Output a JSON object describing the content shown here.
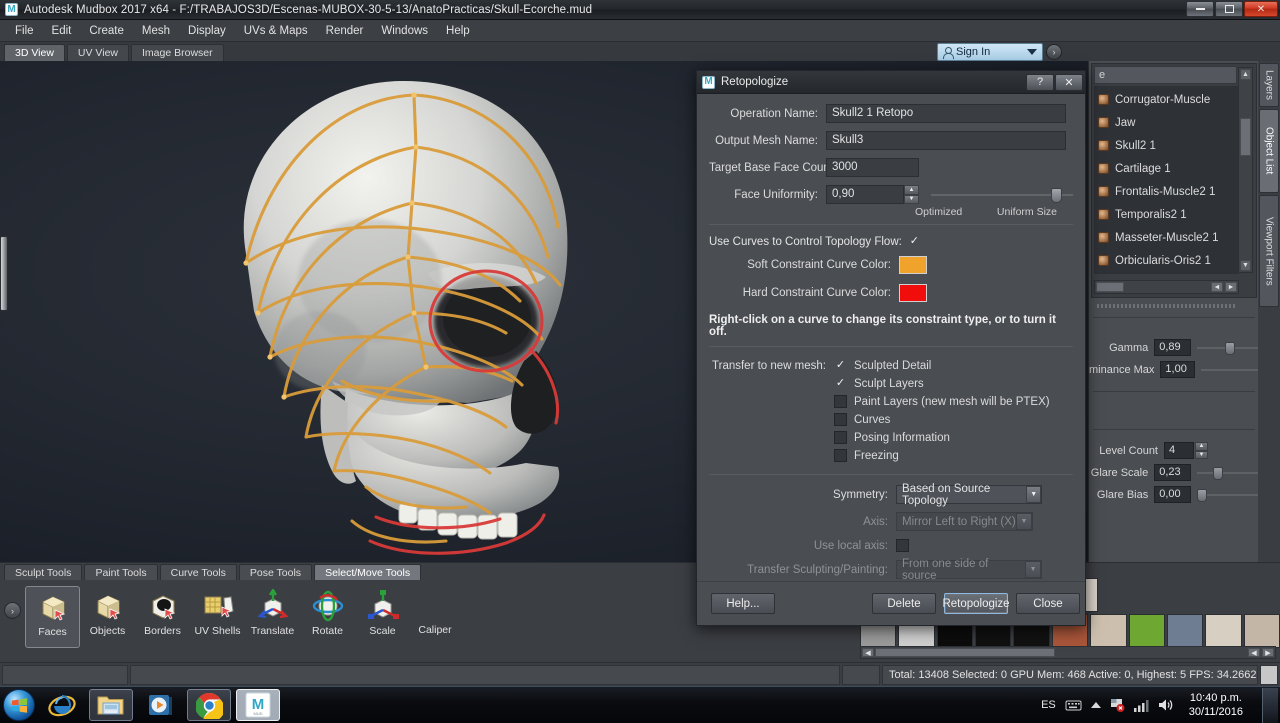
{
  "window": {
    "title": "Autodesk Mudbox 2017 x64 - F:/TRABAJOS3D/Escenas-MUBOX-30-5-13/AnatoPracticas/Skull-Ecorche.mud",
    "logo_letter": "M",
    "controls": {
      "minimize": "—",
      "restore": "❐",
      "close": "✕"
    }
  },
  "menu": {
    "items": [
      "File",
      "Edit",
      "Create",
      "Mesh",
      "Display",
      "UVs & Maps",
      "Render",
      "Windows",
      "Help"
    ]
  },
  "view_tabs": {
    "items": [
      "3D View",
      "UV View",
      "Image Browser"
    ],
    "active": "3D View"
  },
  "signin": {
    "label": "Sign In",
    "icon": "person-icon",
    "caret": "chevron-down-icon",
    "help_icon": "help-circle-icon"
  },
  "side_tabs": {
    "items": [
      "Layers",
      "Object List",
      "Viewport Filters"
    ],
    "active": "Object List"
  },
  "object_list": {
    "header_value": "e",
    "items": [
      "Corrugator-Muscle",
      "Jaw",
      "Skull2 1",
      "Cartilage 1",
      "Frontalis-Muscle2 1",
      "Temporalis2 1",
      "Masseter-Muscle2 1",
      "Orbicularis-Oris2 1"
    ],
    "scroll_up": "▲",
    "scroll_down": "▼",
    "scroll_left": "◄",
    "scroll_right": "►"
  },
  "viewport_props": {
    "gamma": {
      "label": "Gamma",
      "value": "0,89"
    },
    "luminance_max": {
      "label": "minance Max",
      "value": "1,00"
    },
    "level_count": {
      "label": "Level Count",
      "value": "4"
    },
    "glare_scale": {
      "label": "Glare Scale",
      "value": "0,23"
    },
    "glare_bias": {
      "label": "Glare Bias",
      "value": "0,00"
    }
  },
  "tool_tabs": {
    "items": [
      "Sculpt Tools",
      "Paint Tools",
      "Curve Tools",
      "Pose Tools",
      "Select/Move Tools"
    ],
    "active": "Select/Move Tools"
  },
  "tools": [
    {
      "label": "Faces",
      "icon": "cube-faces-icon",
      "selected": true
    },
    {
      "label": "Objects",
      "icon": "cube-objects-icon",
      "selected": false
    },
    {
      "label": "Borders",
      "icon": "cube-borders-icon",
      "selected": false
    },
    {
      "label": "UV Shells",
      "icon": "uv-shells-icon",
      "selected": false
    },
    {
      "label": "Translate",
      "icon": "translate-gizmo-icon",
      "selected": false
    },
    {
      "label": "Rotate",
      "icon": "rotate-gizmo-icon",
      "selected": false
    },
    {
      "label": "Scale",
      "icon": "scale-gizmo-icon",
      "selected": false
    },
    {
      "label": "Caliper",
      "icon": "caliper-icon",
      "selected": false
    }
  ],
  "collapse_knob": "›",
  "statusbar": {
    "text": "Total: 13408  Selected: 0 GPU Mem: 468  Active: 0, Highest: 5  FPS: 34.2662"
  },
  "tray": {
    "row1": [
      "#141414",
      "#8d8d8d",
      "#a0a0a0",
      "#6b6b6b",
      "#b9aa9a",
      "#d8d2c8"
    ],
    "row2": [
      "#9a9a9a",
      "#cfcfcf",
      "#0c0c0c",
      "#101010",
      "#111111",
      "#a8553a",
      "#cdbfae",
      "#6ea832",
      "#6f7d93",
      "#d7cfc2",
      "#c3b6a6",
      "#cfcfcf"
    ]
  },
  "dialog": {
    "title": "Retopologize",
    "logo_letter": "M",
    "help_btn": "?",
    "close_btn": "✕",
    "fields": {
      "operation_name": {
        "label": "Operation Name:",
        "value": "Skull2 1 Retopo"
      },
      "output_mesh_name": {
        "label": "Output Mesh Name:",
        "value": "Skull3"
      },
      "target_base_face_count": {
        "label": "Target Base Face Count:",
        "value": "3000"
      },
      "face_uniformity": {
        "label": "Face Uniformity:",
        "value": "0,90",
        "slider_percent": 90,
        "left_caption": "Optimized",
        "right_caption": "Uniform Size"
      }
    },
    "use_curves": {
      "label": "Use Curves to Control Topology Flow:",
      "checked": true
    },
    "soft_constraint": {
      "label": "Soft Constraint Curve Color:",
      "color": "#f0a32a"
    },
    "hard_constraint": {
      "label": "Hard Constraint Curve Color:",
      "color": "#f20d0d"
    },
    "hint": "Right-click on a curve to change its constraint type, or to turn it off.",
    "transfer": {
      "label": "Transfer to new mesh:",
      "items": [
        {
          "label": "Sculpted Detail",
          "checked": true
        },
        {
          "label": "Sculpt Layers",
          "checked": true
        },
        {
          "label": "Paint Layers (new mesh will be PTEX)",
          "checked": false
        },
        {
          "label": "Curves",
          "checked": false
        },
        {
          "label": "Posing Information",
          "checked": false
        },
        {
          "label": "Freezing",
          "checked": false
        }
      ]
    },
    "symmetry": {
      "label": "Symmetry:",
      "value": "Based on Source Topology",
      "disabled": false
    },
    "axis": {
      "label": "Axis:",
      "value": "Mirror Left to Right (X)",
      "disabled": true
    },
    "use_local_axis": {
      "label": "Use local axis:",
      "checked": false,
      "disabled": true
    },
    "transfer_sculpting": {
      "label": "Transfer Sculpting/Painting:",
      "value": "From one side of source",
      "disabled": true
    },
    "buttons": {
      "help": "Help...",
      "delete": "Delete",
      "retopologize": "Retopologize",
      "close": "Close"
    }
  },
  "taskbar": {
    "start": "windows-start-icon",
    "items": [
      "internet-explorer-icon",
      "file-explorer-icon",
      "media-player-icon",
      "chrome-icon",
      "mudbox-icon"
    ],
    "tray": {
      "language": "ES",
      "keyboard": "keyboard-icon",
      "chevron": "chevron-up-icon",
      "flag": "flag-icon",
      "network": "network-signal-icon",
      "volume": "volume-icon"
    },
    "clock": {
      "time": "10:40 p.m.",
      "date": "30/11/2016"
    }
  }
}
